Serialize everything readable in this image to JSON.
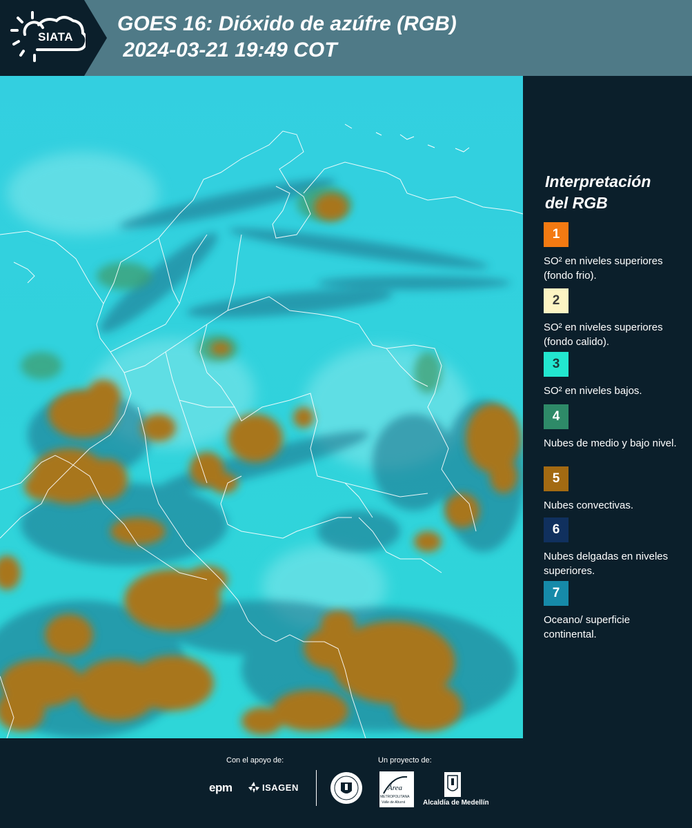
{
  "header": {
    "logo_text": "SIATA",
    "title_line1": "GOES 16: Dióxido de azúfre (RGB)",
    "title_line2": " 2024-03-21 19:49 COT"
  },
  "legend": {
    "title_line1": "Interpretación",
    "title_line2": "del RGB",
    "items": [
      {
        "number": "1",
        "color": "#f47a12",
        "label": "SO² en niveles superiores (fondo frio)."
      },
      {
        "number": "2",
        "color": "#fdf4c3",
        "label": "SO² en niveles superiores (fondo calido)."
      },
      {
        "number": "3",
        "color": "#22e6cf",
        "label": "SO² en niveles bajos."
      },
      {
        "number": "4",
        "color": "#2e8a68",
        "label": "Nubes de medio y bajo nivel."
      },
      {
        "number": "5",
        "color": "#a36a12",
        "label": "Nubes convectivas."
      },
      {
        "number": "6",
        "color": "#10305e",
        "label": "Nubes delgadas en niveles superiores."
      },
      {
        "number": "7",
        "color": "#168aa9",
        "label": "Oceano/ superficie continental."
      }
    ]
  },
  "footer": {
    "support_label": "Con el apoyo de:",
    "project_label": "Un proyecto de:",
    "epm": "epm",
    "isagen": "ISAGEN",
    "metropolitana": "METROPOLITANA",
    "area": "Área",
    "valle": "Valle de Aburrá",
    "alcaldia": "Alcaldía de Medellín"
  },
  "icons": {
    "siata_logo": "sun-cloud-icon",
    "isagen_logo": "isagen-logo-icon",
    "medellin_seal": "medellin-seal-icon",
    "area_logo": "area-metropolitana-logo",
    "alcaldia_logo": "alcaldia-shield-icon"
  }
}
